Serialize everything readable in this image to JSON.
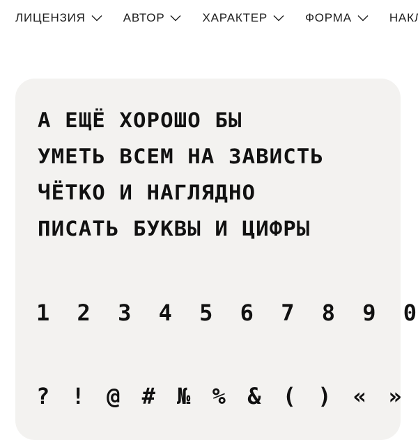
{
  "nav": {
    "items": [
      {
        "label": "ЛИЦЕНЗИЯ"
      },
      {
        "label": "АВТОР"
      },
      {
        "label": "ХАРАКТЕР"
      },
      {
        "label": "ФОРМА"
      },
      {
        "label": "НАКЛОН"
      }
    ]
  },
  "specimen": {
    "lines": [
      "А ЕЩЁ ХОРОШО БЫ",
      "УМЕТЬ ВСЕМ НА ЗАВИСТЬ",
      "ЧЁТКО И НАГЛЯДНО",
      "ПИСАТЬ БУКВЫ И ЦИФРЫ"
    ],
    "digits": "1 2 3 4 5 6 7 8 9 0",
    "symbols": "? ! @ # № % & ( ) « »"
  },
  "colors": {
    "card_background": "#f3f2f0",
    "text": "#111111"
  }
}
